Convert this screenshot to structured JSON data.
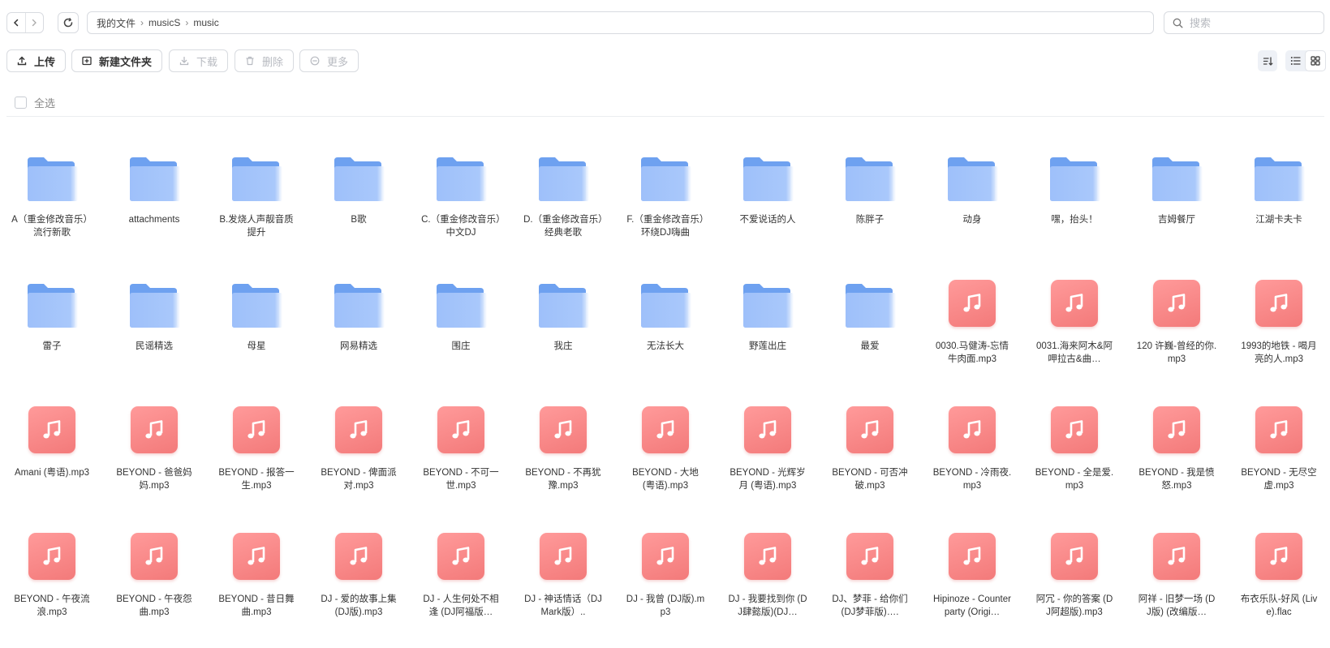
{
  "nav": {
    "back": "‹",
    "forward": "›"
  },
  "breadcrumb": [
    "我的文件",
    "musicS",
    "music"
  ],
  "search": {
    "placeholder": "搜索"
  },
  "toolbar": {
    "upload": "上传",
    "new_folder": "新建文件夹",
    "download": "下载",
    "delete": "删除",
    "more": "更多"
  },
  "select_all": "全选",
  "colors": {
    "folder": "#6ea1f0",
    "music": "#f37a7a",
    "border": "#d8dbe0"
  },
  "items": [
    {
      "type": "folder",
      "name": "A（重金修改音乐）流行新歌"
    },
    {
      "type": "folder",
      "name": "attachments"
    },
    {
      "type": "folder",
      "name": "B.发烧人声靓音质提升"
    },
    {
      "type": "folder",
      "name": "B歌"
    },
    {
      "type": "folder",
      "name": "C.（重金修改音乐）中文DJ"
    },
    {
      "type": "folder",
      "name": "D.（重金修改音乐）经典老歌"
    },
    {
      "type": "folder",
      "name": "F.（重金修改音乐）环绕DJ嗨曲"
    },
    {
      "type": "folder",
      "name": "不爱说话的人"
    },
    {
      "type": "folder",
      "name": "陈胖子"
    },
    {
      "type": "folder",
      "name": "动身"
    },
    {
      "type": "folder",
      "name": "嘿，抬头！"
    },
    {
      "type": "folder",
      "name": "吉姆餐厅"
    },
    {
      "type": "folder",
      "name": "江湖卡夫卡"
    },
    {
      "type": "folder",
      "name": "雷子"
    },
    {
      "type": "folder",
      "name": "民谣精选"
    },
    {
      "type": "folder",
      "name": "母星"
    },
    {
      "type": "folder",
      "name": "网易精选"
    },
    {
      "type": "folder",
      "name": "围庄"
    },
    {
      "type": "folder",
      "name": "我庄"
    },
    {
      "type": "folder",
      "name": "无法长大"
    },
    {
      "type": "folder",
      "name": "野莲出庄"
    },
    {
      "type": "folder",
      "name": "最爱"
    },
    {
      "type": "music",
      "name": "0030.马健涛-忘情牛肉面.mp3"
    },
    {
      "type": "music",
      "name": "0031.海来阿木&阿呷拉古&曲…"
    },
    {
      "type": "music",
      "name": "120 许巍-曾经的你.mp3"
    },
    {
      "type": "music",
      "name": "1993的地铁 - 喝月亮的人.mp3"
    },
    {
      "type": "music",
      "name": "Amani (粤语).mp3"
    },
    {
      "type": "music",
      "name": "BEYOND - 爸爸妈妈.mp3"
    },
    {
      "type": "music",
      "name": "BEYOND - 报答一生.mp3"
    },
    {
      "type": "music",
      "name": "BEYOND - 俾面派对.mp3"
    },
    {
      "type": "music",
      "name": "BEYOND - 不可一世.mp3"
    },
    {
      "type": "music",
      "name": "BEYOND - 不再犹豫.mp3"
    },
    {
      "type": "music",
      "name": "BEYOND - 大地 (粤语).mp3"
    },
    {
      "type": "music",
      "name": "BEYOND - 光辉岁月 (粤语).mp3"
    },
    {
      "type": "music",
      "name": "BEYOND - 可否冲破.mp3"
    },
    {
      "type": "music",
      "name": "BEYOND - 冷雨夜.mp3"
    },
    {
      "type": "music",
      "name": "BEYOND - 全是爱.mp3"
    },
    {
      "type": "music",
      "name": "BEYOND - 我是愤怒.mp3"
    },
    {
      "type": "music",
      "name": "BEYOND - 无尽空虚.mp3"
    },
    {
      "type": "music",
      "name": "BEYOND - 午夜流浪.mp3"
    },
    {
      "type": "music",
      "name": "BEYOND - 午夜怨曲.mp3"
    },
    {
      "type": "music",
      "name": "BEYOND - 昔日舞曲.mp3"
    },
    {
      "type": "music",
      "name": "DJ - 爱的故事上集 (DJ版).mp3"
    },
    {
      "type": "music",
      "name": "DJ - 人生何处不相逢 (DJ阿福版…"
    },
    {
      "type": "music",
      "name": "DJ - 神话情话（DJ Mark版）.."
    },
    {
      "type": "music",
      "name": "DJ - 我曾 (DJ版).mp3"
    },
    {
      "type": "music",
      "name": "DJ - 我要找到你 (DJ肆懿版)(DJ…"
    },
    {
      "type": "music",
      "name": "DJ、梦菲 - 给你们 (DJ梦菲版)…."
    },
    {
      "type": "music",
      "name": "Hipinoze - Counterparty (Origi…"
    },
    {
      "type": "music",
      "name": "阿冗 - 你的答案 (DJ阿超版).mp3"
    },
    {
      "type": "music",
      "name": "阿祥 - 旧梦一场 (DJ版) (改编版…"
    },
    {
      "type": "music",
      "name": "布衣乐队-好风 (Live).flac"
    }
  ]
}
